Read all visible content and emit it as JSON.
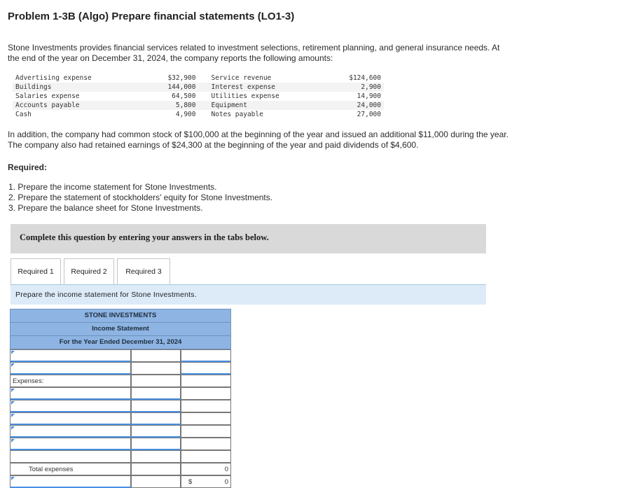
{
  "problem": {
    "title": "Problem 1-3B (Algo) Prepare financial statements (LO1-3)",
    "intro_line1": "Stone Investments provides financial services related to investment selections, retirement planning, and general insurance needs. At",
    "intro_line2": "the end of the year on December 31, 2024, the company reports the following amounts:"
  },
  "accounts": [
    {
      "name1": "Advertising expense",
      "amt1": "$32,900",
      "name2": "Service revenue",
      "amt2": "$124,600"
    },
    {
      "name1": "Buildings",
      "amt1": "144,000",
      "name2": "Interest expense",
      "amt2": "2,900"
    },
    {
      "name1": "Salaries expense",
      "amt1": "64,500",
      "name2": "Utilities expense",
      "amt2": "14,900"
    },
    {
      "name1": "Accounts payable",
      "amt1": "5,800",
      "name2": "Equipment",
      "amt2": "24,000"
    },
    {
      "name1": "Cash",
      "amt1": "4,900",
      "name2": "Notes payable",
      "amt2": "27,000"
    }
  ],
  "addition_line1": "In addition, the company had common stock of $100,000 at the beginning of the year and issued an additional $11,000 during the year.",
  "addition_line2": "The company also had retained earnings of $24,300 at the beginning of the year and paid dividends of $4,600.",
  "required_heading": "Required:",
  "requirements": [
    "1. Prepare the income statement for Stone Investments.",
    "2. Prepare the statement of stockholders’ equity for Stone Investments.",
    "3. Prepare the balance sheet for Stone Investments."
  ],
  "instruction": "Complete this question by entering your answers in the tabs below.",
  "tabs": [
    "Required 1",
    "Required 2",
    "Required 3"
  ],
  "prompt": "Prepare the income statement for Stone Investments.",
  "statement": {
    "company": "STONE INVESTMENTS",
    "name": "Income Statement",
    "period": "For the Year Ended December 31, 2024",
    "expenses_label": "Expenses:",
    "total_expenses_label": "Total expenses",
    "currency_symbol": "$",
    "total_expenses_value": "0",
    "net_value": "0"
  }
}
